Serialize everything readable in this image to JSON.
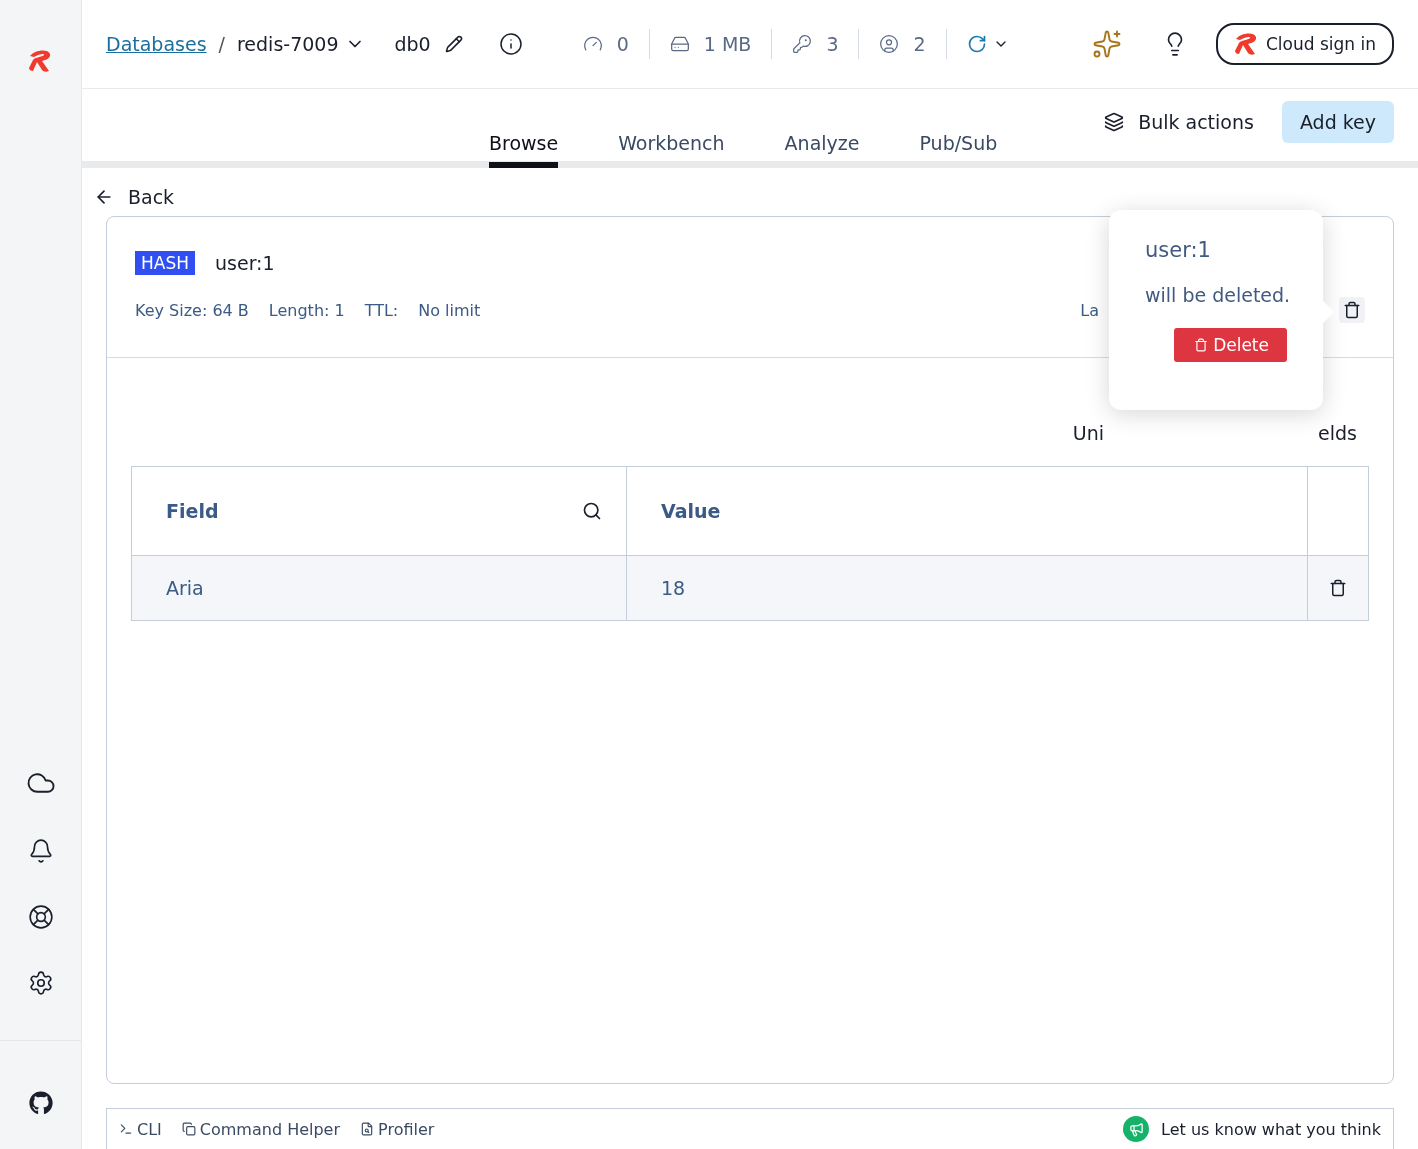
{
  "breadcrumb": {
    "link": "Databases",
    "separator": "/",
    "database": "redis-7009",
    "db": "db0"
  },
  "stats": [
    {
      "kind": "speed",
      "value": "0"
    },
    {
      "kind": "memory",
      "value": "1 MB"
    },
    {
      "kind": "keys",
      "value": "3"
    },
    {
      "kind": "clients",
      "value": "2"
    }
  ],
  "cloud_button": "Cloud sign in",
  "tabs": [
    {
      "label": "Browse",
      "selected": true
    },
    {
      "label": "Workbench",
      "selected": false
    },
    {
      "label": "Analyze",
      "selected": false
    },
    {
      "label": "Pub/Sub",
      "selected": false
    }
  ],
  "bulk_actions": "Bulk actions",
  "add_key": "Add key",
  "back": "Back",
  "key": {
    "type": "HASH",
    "name": "user:1",
    "size": "Key Size: 64 B",
    "length": "Length: 1",
    "ttl_label": "TTL:",
    "ttl": "No limit",
    "cut_label": "La"
  },
  "subheader": {
    "left_fragment": "Uni",
    "right_fragment": "elds"
  },
  "table": {
    "columns": [
      "Field",
      "Value"
    ],
    "rows": [
      {
        "field": "Aria",
        "value": "18"
      }
    ]
  },
  "popover": {
    "title": "user:1",
    "message": "will be deleted.",
    "button": "Delete"
  },
  "footer": {
    "tools": [
      {
        "kind": "cli",
        "label": "CLI"
      },
      {
        "kind": "helper",
        "label": "Command Helper"
      },
      {
        "kind": "profiler",
        "label": "Profiler"
      }
    ],
    "feedback": "Let us know what you think"
  }
}
